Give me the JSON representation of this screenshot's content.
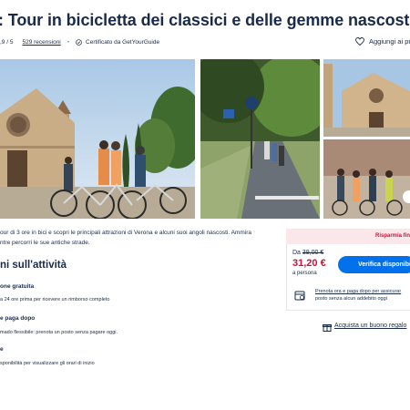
{
  "header": {
    "title": ": Tour in bicicletta dei classici e delle gemme nascoste",
    "rating": ",9 / 5",
    "reviews": "529 recensioni",
    "certified": "Certificato da GetYourGuide",
    "wishlist": "Aggiungi ai pref"
  },
  "gallery": {
    "photos": [
      "Basilica di San Zeno con ciclisti",
      "Ciclisti in fila su pista ciclabile",
      "Facciata della basilica",
      "Gruppo di ciclisti sotto le mura"
    ]
  },
  "description": {
    "line1": "our di 3 ore in bici e scopri le principali attrazioni di Verona e alcuni suoi angoli nascosti. Ammira",
    "line2": "ntre percorri le sue antiche strade."
  },
  "about": {
    "title": "ni sull'attività",
    "items": [
      {
        "title": "one gratuita",
        "text": "a 24 ore prima per ricevere un rimborso completo"
      },
      {
        "title": "e paga dopo",
        "text": "mado flessibile: prenota un posto senza pagare oggi."
      },
      {
        "title": "e",
        "text": "sponibilità per visualizzare gli orari di inizio"
      }
    ]
  },
  "booking": {
    "badge": "Risparmia fin",
    "from_label": "Da",
    "old_price": "39,00 €",
    "new_price": "31,20 €",
    "per_person": "a persona",
    "check_button": "Verifica disponibil",
    "reserve_link": "Prenota ora e paga dopo",
    "reserve_link_tail": " per assicurar",
    "reserve_text": "posto senza alcun addebito oggi",
    "gift_link": "Acquista un buono regalo"
  },
  "colors": {
    "text": "#1a2b49",
    "accent_blue": "#0071eb",
    "price_red": "#d10f3a",
    "badge_bg": "#fbe6e9"
  },
  "icons": [
    "certified-icon",
    "heart-icon",
    "calendar-card-icon",
    "gift-icon"
  ]
}
